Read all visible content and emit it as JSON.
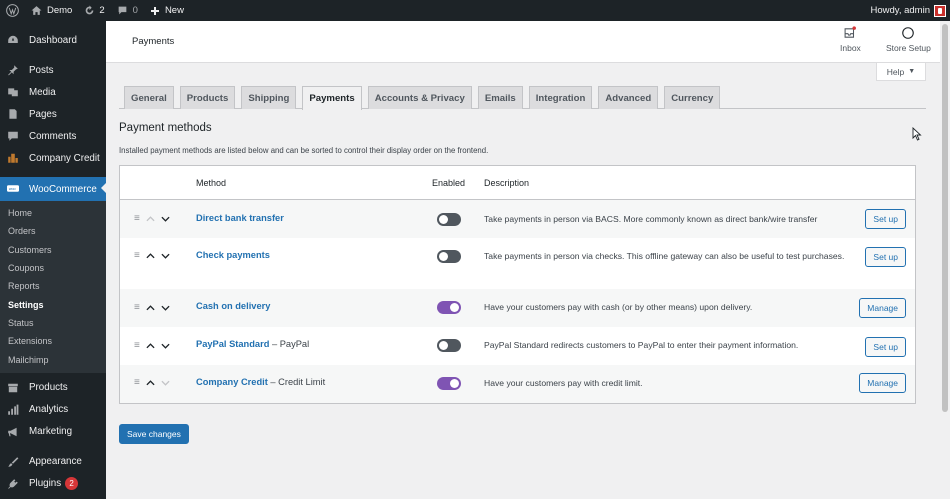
{
  "admin_bar": {
    "site_name": "Demo",
    "updates_count": "2",
    "comments_count": "0",
    "new_label": "New",
    "greeting": "Howdy, admin"
  },
  "sidebar": {
    "items": [
      {
        "label": "Dashboard",
        "icon": "dashboard-icon"
      },
      {
        "label": "Posts",
        "icon": "pin-icon"
      },
      {
        "label": "Media",
        "icon": "media-icon"
      },
      {
        "label": "Pages",
        "icon": "page-icon"
      },
      {
        "label": "Comments",
        "icon": "comment-icon"
      },
      {
        "label": "Company Credit",
        "icon": "building-icon"
      },
      {
        "label": "WooCommerce",
        "icon": "woo-icon"
      }
    ],
    "woo_submenu": [
      "Home",
      "Orders",
      "Customers",
      "Coupons",
      "Reports",
      "Settings",
      "Status",
      "Extensions",
      "Mailchimp"
    ],
    "lower_items": [
      {
        "label": "Products",
        "icon": "archive-icon"
      },
      {
        "label": "Analytics",
        "icon": "bar-chart-icon"
      },
      {
        "label": "Marketing",
        "icon": "megaphone-icon"
      },
      {
        "label": "Appearance",
        "icon": "brush-icon"
      },
      {
        "label": "Plugins",
        "icon": "plug-icon",
        "badge": "2"
      }
    ]
  },
  "header": {
    "title": "Payments",
    "inbox_label": "Inbox",
    "store_setup_label": "Store Setup",
    "help_label": "Help"
  },
  "tabs": [
    "General",
    "Products",
    "Shipping",
    "Payments",
    "Accounts & Privacy",
    "Emails",
    "Integration",
    "Advanced",
    "Currency"
  ],
  "active_tab": "Payments",
  "section": {
    "title": "Payment methods",
    "description": "Installed payment methods are listed below and can be sorted to control their display order on the frontend."
  },
  "table": {
    "headers": {
      "method": "Method",
      "enabled": "Enabled",
      "description": "Description"
    },
    "rows": [
      {
        "name": "Direct bank transfer",
        "sub": "",
        "enabled": false,
        "description": "Take payments in person via BACS. More commonly known as direct bank/wire transfer",
        "action": "Set up"
      },
      {
        "name": "Check payments",
        "sub": "",
        "enabled": false,
        "description": "Take payments in person via checks. This offline gateway can also be useful to test purchases.",
        "action": "Set up"
      },
      {
        "name": "Cash on delivery",
        "sub": "",
        "enabled": true,
        "description": "Have your customers pay with cash (or by other means) upon delivery.",
        "action": "Manage"
      },
      {
        "name": "PayPal Standard",
        "sub": " – PayPal",
        "enabled": false,
        "description": "PayPal Standard redirects customers to PayPal to enter their payment information.",
        "action": "Set up"
      },
      {
        "name": "Company Credit",
        "sub": " – Credit Limit",
        "enabled": true,
        "description": "Have your customers pay with credit limit.",
        "action": "Manage"
      }
    ]
  },
  "save_label": "Save changes",
  "colors": {
    "accent": "#2271b1",
    "toggle_on": "#7f54b3",
    "admin_dark": "#1d2327"
  }
}
